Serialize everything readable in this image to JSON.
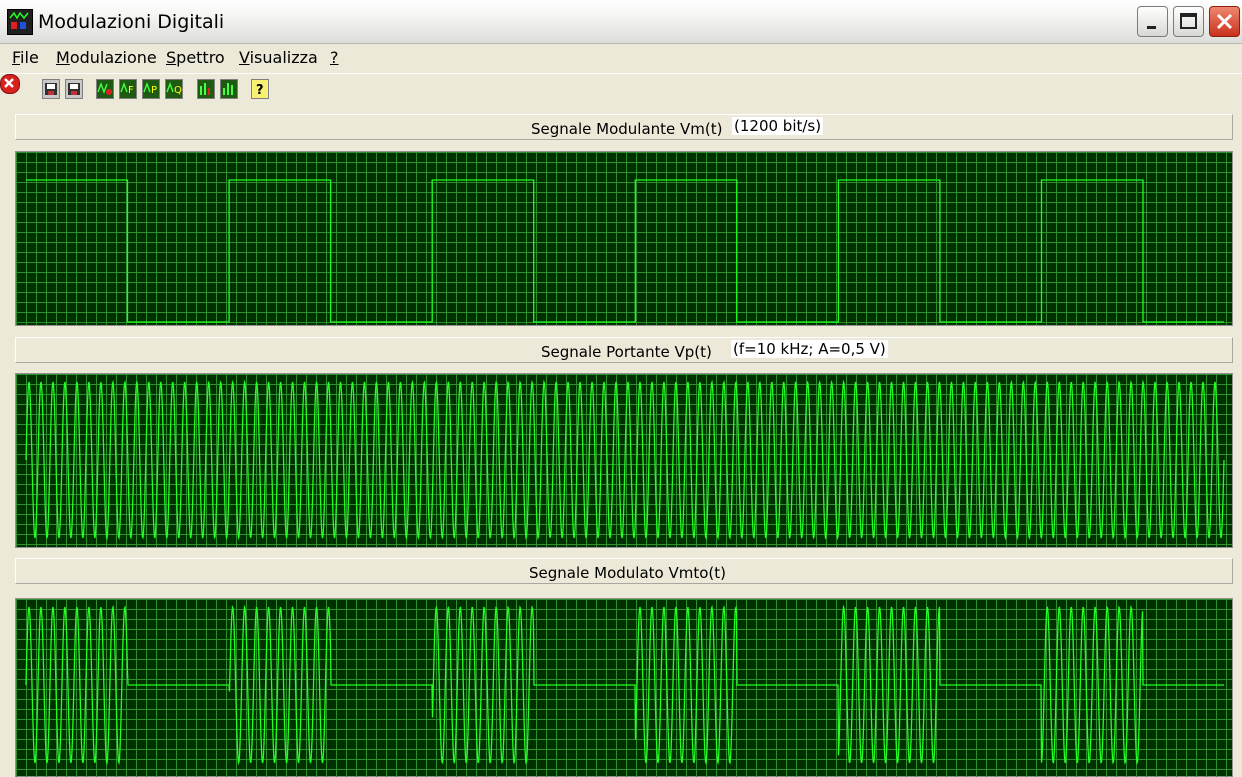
{
  "window": {
    "title": "Modulazioni Digitali",
    "minimize_label": "_",
    "maximize_label": "□",
    "close_label": "×"
  },
  "menu": [
    {
      "label": "File",
      "underline": "F"
    },
    {
      "label": "Modulazione",
      "underline": "M"
    },
    {
      "label": "Spettro",
      "underline": "S"
    },
    {
      "label": "Visualizza",
      "underline": "V"
    },
    {
      "label": "?",
      "underline": "?"
    }
  ],
  "toolbar": [
    {
      "name": "exit-icon"
    },
    {
      "name": "save-icon"
    },
    {
      "name": "save-as-icon"
    },
    {
      "name": "modulation-ask-icon"
    },
    {
      "name": "modulation-fsk-icon"
    },
    {
      "name": "modulation-psk-icon"
    },
    {
      "name": "modulation-qam-icon"
    },
    {
      "name": "spectrum-m-icon"
    },
    {
      "name": "spectrum-v-icon"
    },
    {
      "name": "help-icon"
    }
  ],
  "panels": {
    "modulante": {
      "title": "Segnale Modulante Vm(t)",
      "param": "(1200 bit/s)"
    },
    "portante": {
      "title": "Segnale Portante Vp(t)",
      "param": "(f=10 kHz; A=0,5 V)"
    },
    "modulato": {
      "title": "Segnale Modulato Vmto(t)"
    }
  },
  "colors": {
    "scope_bg": "#003000",
    "grid": "#2f8f2f",
    "trace": "#22ff22"
  },
  "signal": {
    "bit_rate_bps": 1200,
    "carrier_freq_khz": 10,
    "carrier_amplitude_v": 0.5,
    "bit_pattern": [
      1,
      0,
      1,
      0,
      1,
      0,
      1,
      0,
      1,
      0,
      1,
      0
    ],
    "carrier_cycles_shown": 100
  }
}
